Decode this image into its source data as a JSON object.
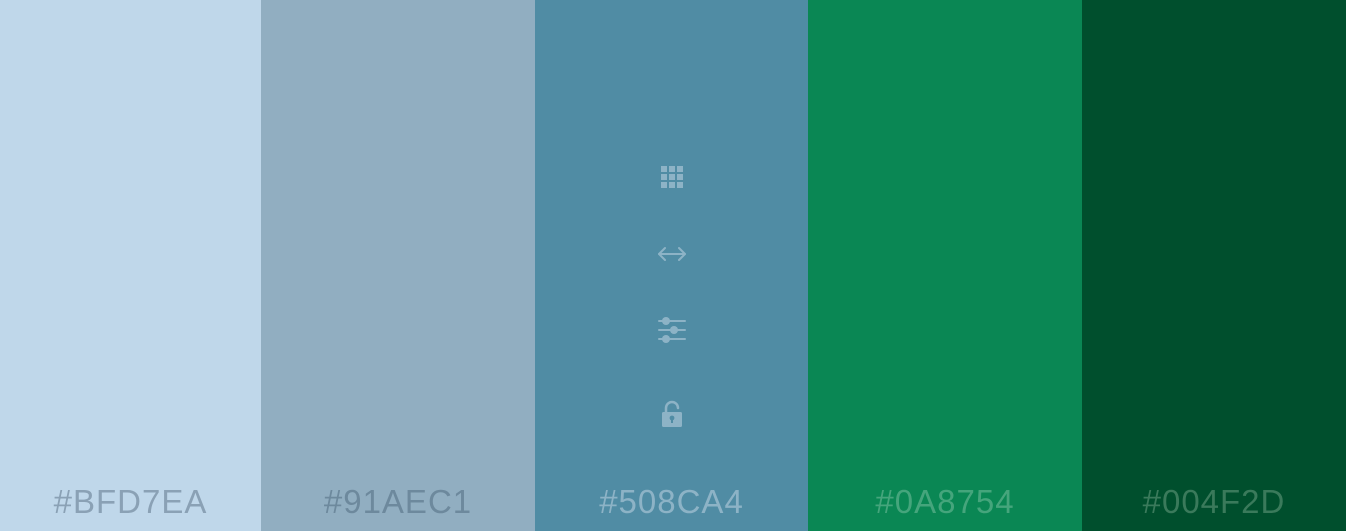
{
  "palette": {
    "swatches": [
      {
        "hex": "#BFD7EA",
        "color": "#BFD7EA",
        "label_color": "#8AA1B5"
      },
      {
        "hex": "#91AEC1",
        "color": "#91AEC1",
        "label_color": "#6D899D"
      },
      {
        "hex": "#508CA4",
        "color": "#508CA4",
        "label_color": "#8DB3C6"
      },
      {
        "hex": "#0A8754",
        "color": "#0A8754",
        "label_color": "#45A57C"
      },
      {
        "hex": "#004F2D",
        "color": "#004F2D",
        "label_color": "#3A7A5B"
      }
    ],
    "active_swatch_tools": {
      "icon_color": "#8DB3C6",
      "icons": [
        "grid-icon",
        "drag-horizontal-icon",
        "adjust-sliders-icon",
        "lock-icon"
      ]
    }
  }
}
